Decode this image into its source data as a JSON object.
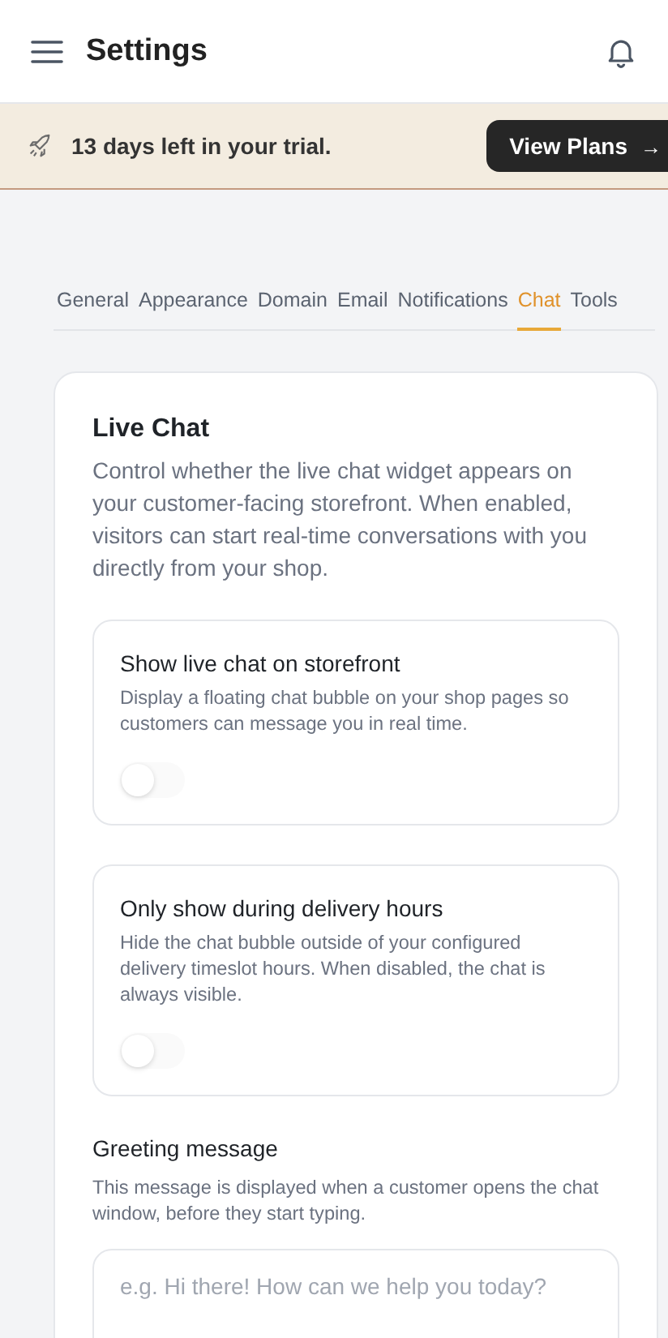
{
  "header": {
    "title": "Settings"
  },
  "trial_banner": {
    "message": "13 days left in your trial.",
    "button": "View Plans",
    "button_arrow": "→"
  },
  "tabs": [
    {
      "label": "General",
      "selected": false
    },
    {
      "label": "Appearance",
      "selected": false
    },
    {
      "label": "Domain",
      "selected": false
    },
    {
      "label": "Email",
      "selected": false
    },
    {
      "label": "Notifications",
      "selected": false
    },
    {
      "label": "Chat",
      "selected": true
    },
    {
      "label": "Tools",
      "selected": false
    }
  ],
  "section": {
    "title": "Live Chat",
    "description": "Control whether the live chat widget appears on your customer-facing storefront. When enabled, visitors can start real-time conversations with you directly from your shop."
  },
  "settings": [
    {
      "title": "Show live chat on storefront",
      "description": "Display a floating chat bubble on your shop pages so customers can message you in real time.",
      "checked": false
    },
    {
      "title": "Only show during delivery hours",
      "description": "Hide the chat bubble outside of your configured delivery timeslot hours. When disabled, the chat is always visible.",
      "checked": false
    }
  ],
  "greeting": {
    "label": "Greeting message",
    "help": "This message is displayed when a customer opens the chat window, before they start typing.",
    "placeholder": "e.g. Hi there! How can we help you today?"
  }
}
